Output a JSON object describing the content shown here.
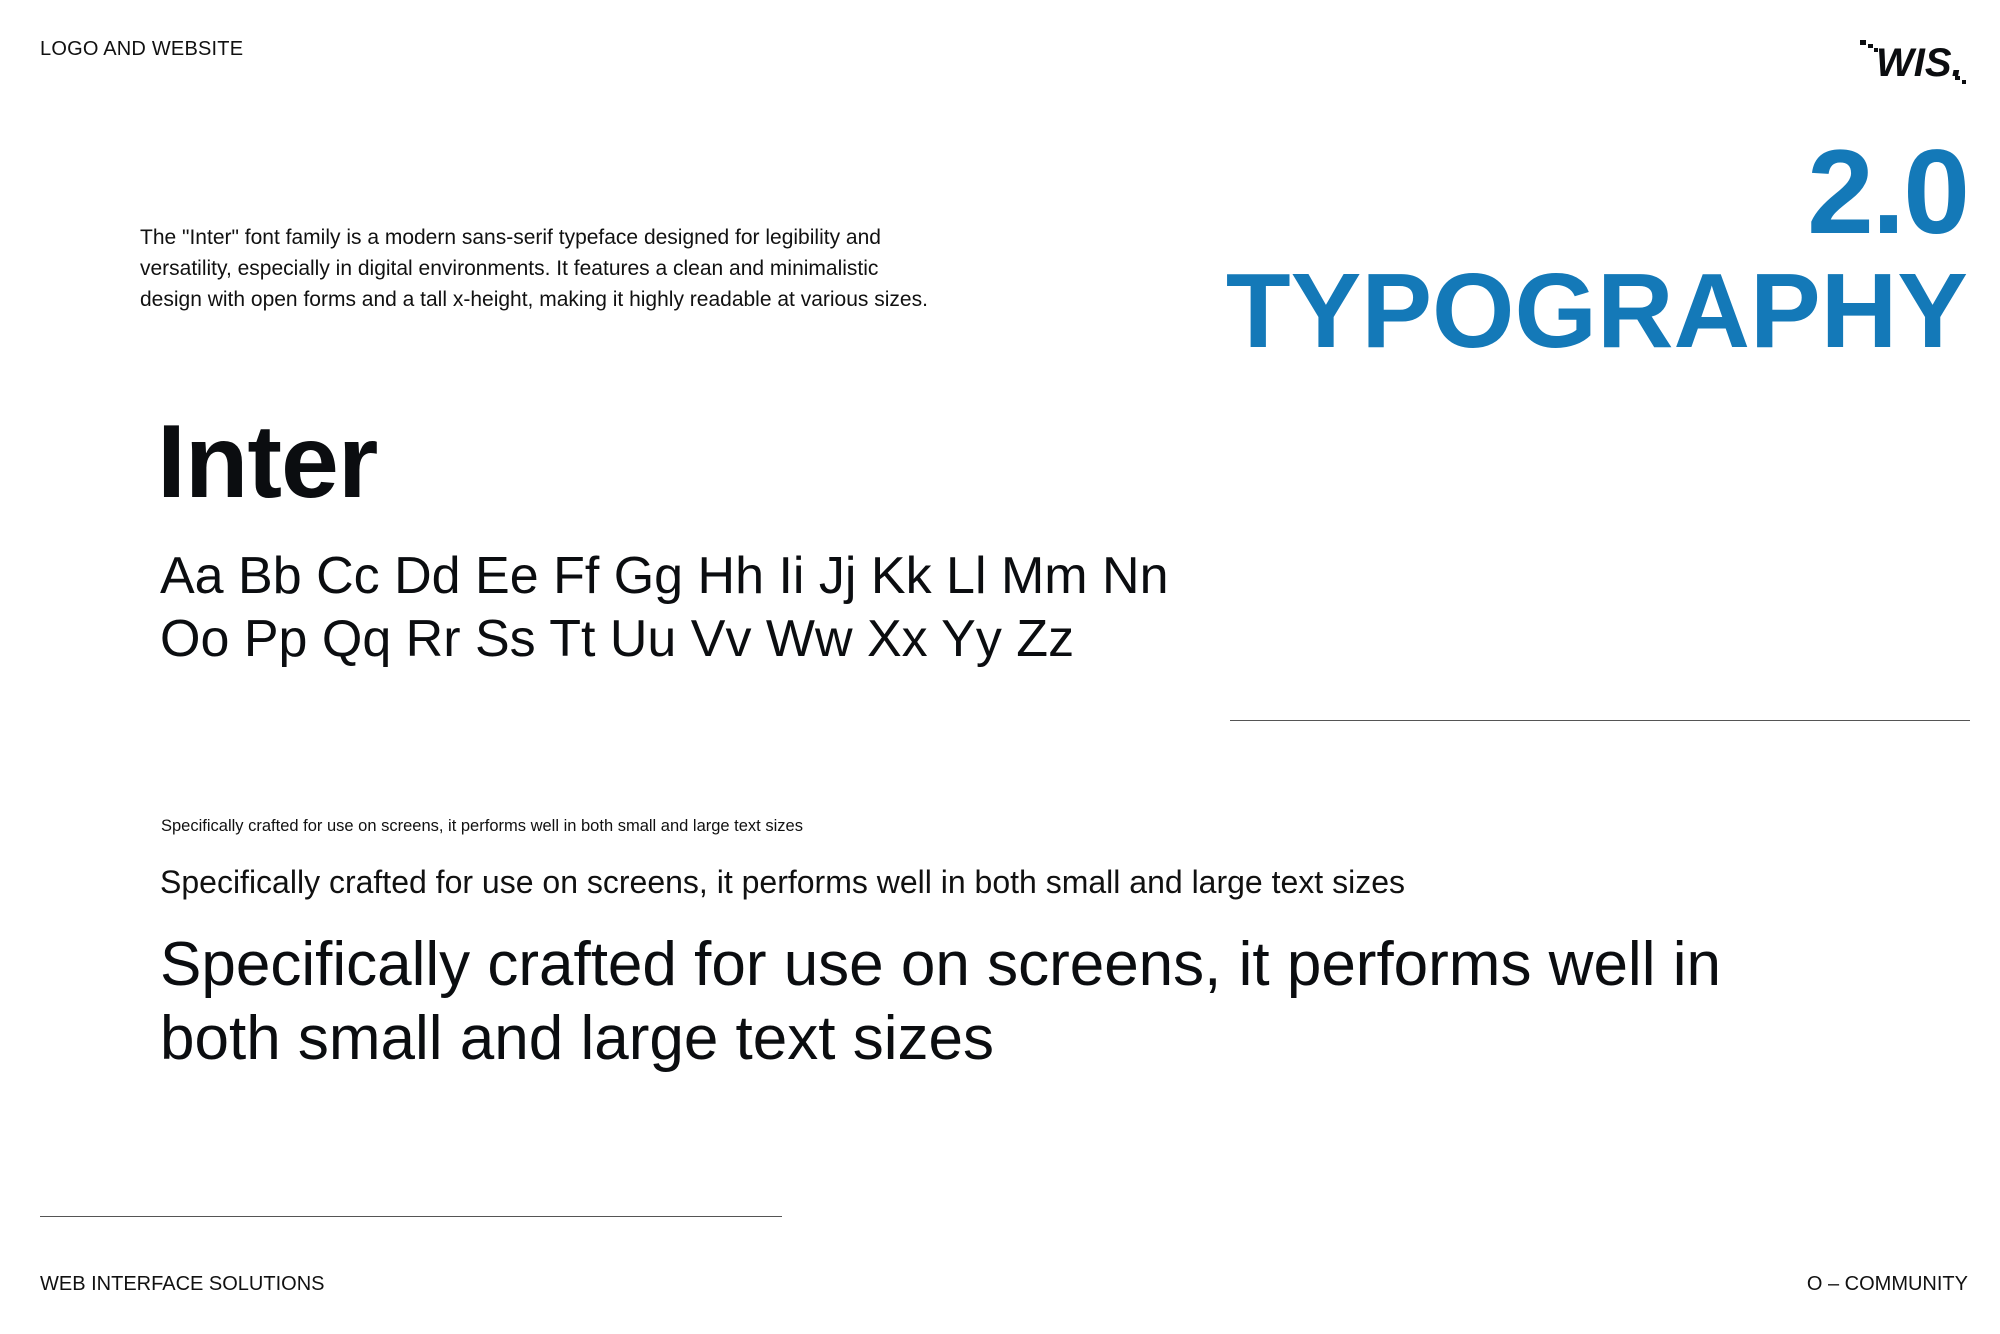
{
  "header": {
    "label": "LOGO AND WEBSITE",
    "logo_text": "WIS."
  },
  "section": {
    "number": "2.0",
    "title": "TYPOGRAPHY"
  },
  "intro": {
    "text": "The \"Inter\" font family is a modern sans-serif typeface designed for legibility and versatility, especially in digital environments. It features a clean and minimalistic design with open forms and a tall x-height, making it highly readable at various sizes."
  },
  "specimen": {
    "font_name": "Inter",
    "alphabet_line1": "Aa Bb Cc Dd Ee Ff Gg Hh Ii Jj Kk Ll Mm Nn",
    "alphabet_line2": "Oo Pp Qq Rr Ss Tt Uu Vv Ww Xx Yy Zz"
  },
  "samples": {
    "small": "Specifically crafted for use on screens, it performs well in both small and large text sizes",
    "medium": "Specifically crafted for use on screens, it performs well in both small and large text sizes",
    "large": "Specifically crafted for use on screens, it performs well in both small and large text sizes"
  },
  "footer": {
    "left": "WEB INTERFACE SOLUTIONS",
    "right": "O – COMMUNITY"
  },
  "colors": {
    "accent": "#1479b8",
    "text": "#0b0d10",
    "rule": "#555555"
  }
}
